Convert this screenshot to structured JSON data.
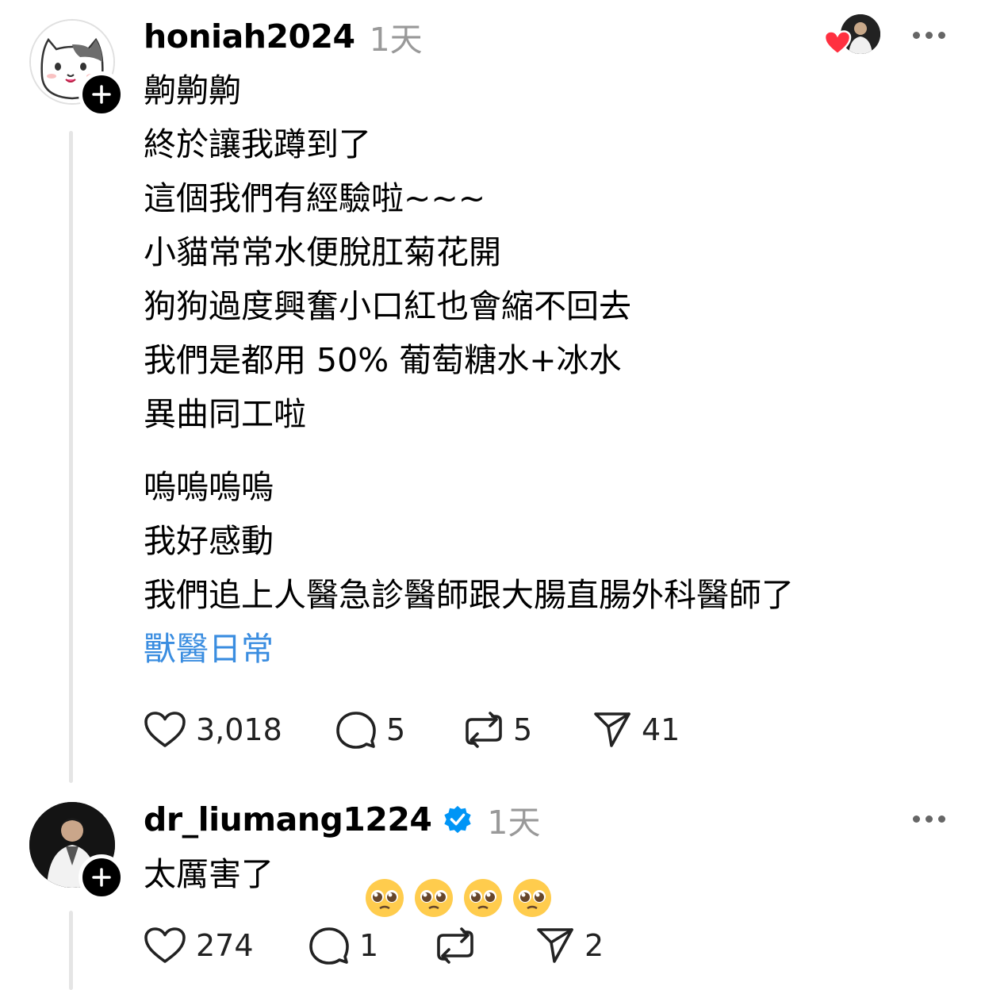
{
  "post": {
    "username": "honiah2024",
    "time": "1天",
    "lines": [
      "齁齁齁",
      "終於讓我蹲到了",
      "這個我們有經驗啦~~~",
      "小貓常常水便脫肛菊花開",
      "狗狗過度興奮小口紅也會縮不回去",
      "我們是都用 50% 葡萄糖水+冰水",
      "異曲同工啦"
    ],
    "lines2": [
      "嗚嗚嗚嗚",
      "我好感動",
      "我們追上人醫急診醫師跟大腸直腸外科醫師了"
    ],
    "tag": "獸醫日常",
    "likes": "3,018",
    "comments": "5",
    "reposts": "5",
    "shares": "41",
    "icons": {
      "avatar": "cat-avatar-icon",
      "like": "heart-icon",
      "comment": "comment-bubble-icon",
      "repost": "repost-icon",
      "share": "send-icon",
      "more": "more-dots-icon",
      "follow": "plus-icon"
    }
  },
  "reply": {
    "username": "dr_liumang1224",
    "time": "1天",
    "text": "太厲害了",
    "emoji": "🥺🥺🥺🥺",
    "likes": "274",
    "comments": "1",
    "reposts": "",
    "shares": "2",
    "icons": {
      "verified": "verified-badge-icon",
      "emoji": "pleading-face-icon"
    }
  },
  "colors": {
    "accent_link": "#3a8de0",
    "heart_red": "#ff3040",
    "verified_blue": "#0095f6",
    "muted": "#999999"
  }
}
